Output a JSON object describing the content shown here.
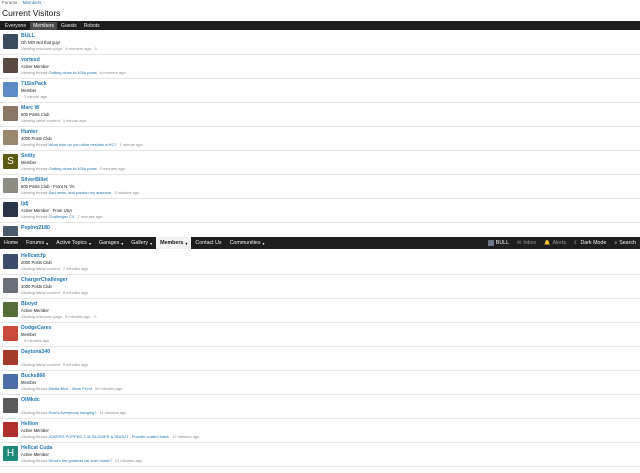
{
  "breadcrumb": {
    "forums": "Forums",
    "sep": "›",
    "members": "Members",
    "sep2": "›"
  },
  "page_title": "Current Visitors",
  "tabs": [
    "Everyone",
    "Members",
    "Guests",
    "Robots"
  ],
  "nav": {
    "items": [
      {
        "label": "Home",
        "caret": ""
      },
      {
        "label": "Forums",
        "caret": "▾"
      },
      {
        "label": "Active Topics",
        "caret": "▾"
      },
      {
        "label": "Garages",
        "caret": "▾"
      },
      {
        "label": "Gallery",
        "caret": "▾"
      },
      {
        "label": "Members",
        "caret": "▾"
      },
      {
        "label": "Contact Us",
        "caret": ""
      },
      {
        "label": "Communities",
        "caret": "▾"
      }
    ],
    "user": "BULL",
    "inbox": "Inbox",
    "alerts": "Alerts",
    "dark_mode": "Dark Mode",
    "search": "Search"
  },
  "colors": {
    "link": "#2577b1",
    "navbar": "#1e1e1e",
    "tabbar": "#1d1d1d"
  },
  "visitors_top": [
    {
      "name": "BULL",
      "title": "Oh NO! Not that guy!",
      "prefix": "Viewing unknown page",
      "link": "",
      "time": "A moment ago",
      "warn": "⚠",
      "avatar": "#3b4a5e"
    },
    {
      "name": "vortexd",
      "title": "Active Member",
      "prefix": "Viewing thread",
      "link": "Getting close to 100k posts",
      "time": "A moment ago",
      "warn": "",
      "avatar": "#5a4a44"
    },
    {
      "name": "71SixPack",
      "title": "Member",
      "prefix": "",
      "link": "",
      "time": "1 minute ago",
      "warn": "",
      "avatar": "#5b8cc8"
    },
    {
      "name": "Marc W",
      "title": "500 Posts Club",
      "prefix": "Viewing latest content",
      "link": "",
      "time": "1 minute ago",
      "warn": "",
      "avatar": "#8a7766"
    },
    {
      "name": "Hunter",
      "title": "4000 Posts Club",
      "prefix": "Viewing thread",
      "link": "What else do you drive besides a HC?",
      "time": "1 minute ago",
      "warn": "",
      "avatar": "#9a8770"
    },
    {
      "name": "Snitty",
      "title": "Member",
      "prefix": "Viewing thread",
      "link": "Getting close to 100k posts",
      "time": "2 minutes ago",
      "warn": "",
      "avatar": "#5b5b12",
      "letter": "S"
    },
    {
      "name": "SilverBillet",
      "title": "500 Posts Club · Front N. VA",
      "prefix": "Viewing thread",
      "link": "Sad news, and pardon my absence",
      "time": "3 minutes ago",
      "warn": "",
      "avatar": "#8d8d83"
    },
    {
      "name": "ljdj",
      "title": "Active Member · From USA",
      "prefix": "Viewing thread",
      "link": "Challenger CV",
      "time": "7 minutes ago",
      "warn": "",
      "avatar": "#2a3348"
    },
    {
      "name": "Pepino2180",
      "title": "",
      "prefix": "",
      "link": "",
      "time": "",
      "warn": "",
      "avatar": "#4a5a6a"
    }
  ],
  "visitors_bottom": [
    {
      "name": "Hellcatcfp",
      "title": "2000 Posts Club",
      "prefix": "Viewing latest content",
      "link": "",
      "time": "7 minutes ago",
      "warn": "",
      "avatar": "#3b4d6b"
    },
    {
      "name": "ChargerChallenger",
      "title": "1000 Posts Club",
      "prefix": "Viewing latest content",
      "link": "",
      "time": "8 minutes ago",
      "warn": "",
      "avatar": "#6a6f78"
    },
    {
      "name": "Bboyd",
      "title": "Active Member",
      "prefix": "Viewing unknown page",
      "link": "",
      "time": "8 minutes ago",
      "warn": "⚠",
      "avatar": "#556b3a"
    },
    {
      "name": "DodgeCares",
      "title": "Member",
      "prefix": "",
      "link": "",
      "time": "9 minutes ago",
      "warn": "",
      "avatar": "#c84a3a"
    },
    {
      "name": "Daytona340",
      "title": "",
      "prefix": "Viewing latest content",
      "link": "",
      "time": "9 minutes ago",
      "warn": "",
      "avatar": "#a33a2a"
    },
    {
      "name": "Bucks866",
      "title": "Member",
      "prefix": "Viewing thread",
      "link": "Media Blue - More Proof",
      "time": "10 minutes ago",
      "warn": "",
      "avatar": "#4a6fa8"
    },
    {
      "name": "OlMkdc",
      "title": "",
      "prefix": "Viewing thread",
      "link": "How's everybody hanging?",
      "time": "11 minutes ago",
      "warn": "",
      "avatar": "#5a5a5a"
    },
    {
      "name": "Hellion",
      "title": "Active Member",
      "prefix": "Viewing thread",
      "link": "JOKERS POPPED 2.4L BLOWER & SNOUT - Powder coated black",
      "time": "12 minutes ago",
      "warn": "",
      "avatar": "#b03030"
    },
    {
      "name": "Hellcat Cuda",
      "title": "Active Member",
      "prefix": "Viewing thread",
      "link": "What's the greatest car ever made?",
      "time": "13 minutes ago",
      "warn": "",
      "avatar": "#1f8a7a",
      "letter": "H"
    }
  ]
}
